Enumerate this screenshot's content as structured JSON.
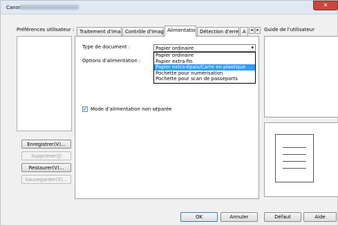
{
  "window": {
    "title": "Canon",
    "close_glyph": "✕"
  },
  "prefs": {
    "label": "Préférences utilisateur :",
    "buttons": {
      "save": "Enregistrer(V)...",
      "delete": "Supprimer(J)",
      "restore": "Restaurer(V)...",
      "backup": "Sauvegarder(X)..."
    }
  },
  "tabs": [
    {
      "label": "Traitement d'image"
    },
    {
      "label": "Contrôle d'image"
    },
    {
      "label": "Alimentation"
    },
    {
      "label": "Détection d'erreur"
    },
    {
      "label": "A"
    }
  ],
  "tab_scroll": {
    "left": "◂",
    "right": "▸"
  },
  "feeding": {
    "doc_type_label": "Type de document :",
    "feed_options_label": "Options d'alimentation :",
    "doc_type_value": "Papier ordinaire",
    "dropdown_arrow": "▾",
    "doc_type_options": [
      "Papier ordinaire",
      "Papier extra-fin",
      "Papier extra-épais/Carte en plastique",
      "Pochette pour numérisation",
      "Pochette pour scan de passeports"
    ],
    "selected_option_index": 2,
    "non_separated_mode_label": "Mode d'alimentation non séparée",
    "non_separated_mode_checked": true
  },
  "guide": {
    "label": "Guide de l'utilisateur"
  },
  "footer": {
    "ok": "OK",
    "cancel": "Annuler",
    "default": "Défaut",
    "help": "Aide"
  }
}
